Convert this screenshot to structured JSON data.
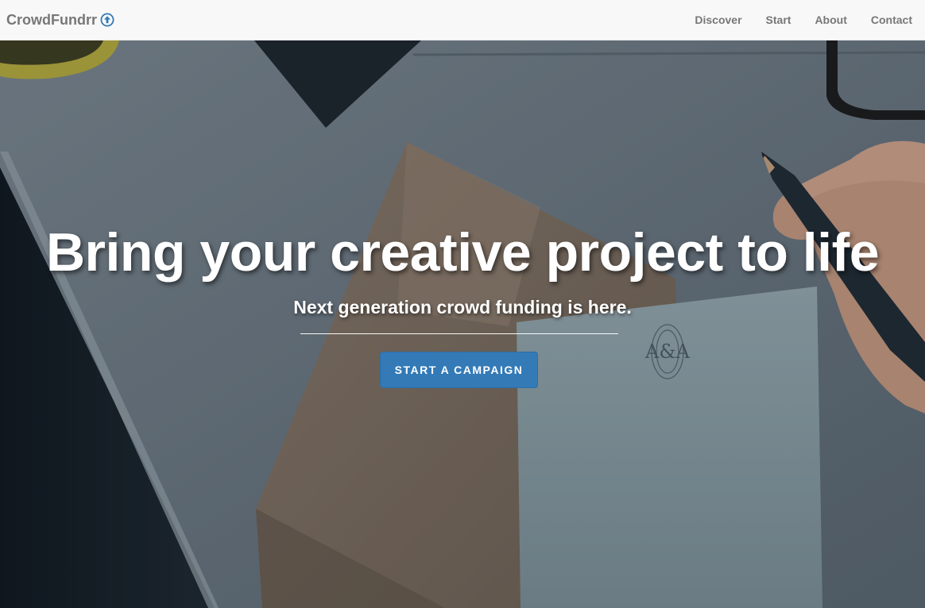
{
  "navbar": {
    "brand": "CrowdFundrr",
    "brand_icon": "arrow-circle-up-icon",
    "links": [
      {
        "label": "Discover"
      },
      {
        "label": "Start"
      },
      {
        "label": "About"
      },
      {
        "label": "Contact"
      }
    ]
  },
  "hero": {
    "headline": "Bring your creative project to life",
    "subheadline": "Next generation crowd funding is here.",
    "cta_label": "START A CAMPAIGN",
    "background_image": "desk-with-envelope-card-pencil-photo",
    "monogram": "A&A"
  },
  "colors": {
    "navbar_bg": "#f8f8f8",
    "nav_text": "#777777",
    "brand_icon": "#337ab7",
    "cta_bg": "#337ab7",
    "headline_text": "#ffffff"
  }
}
